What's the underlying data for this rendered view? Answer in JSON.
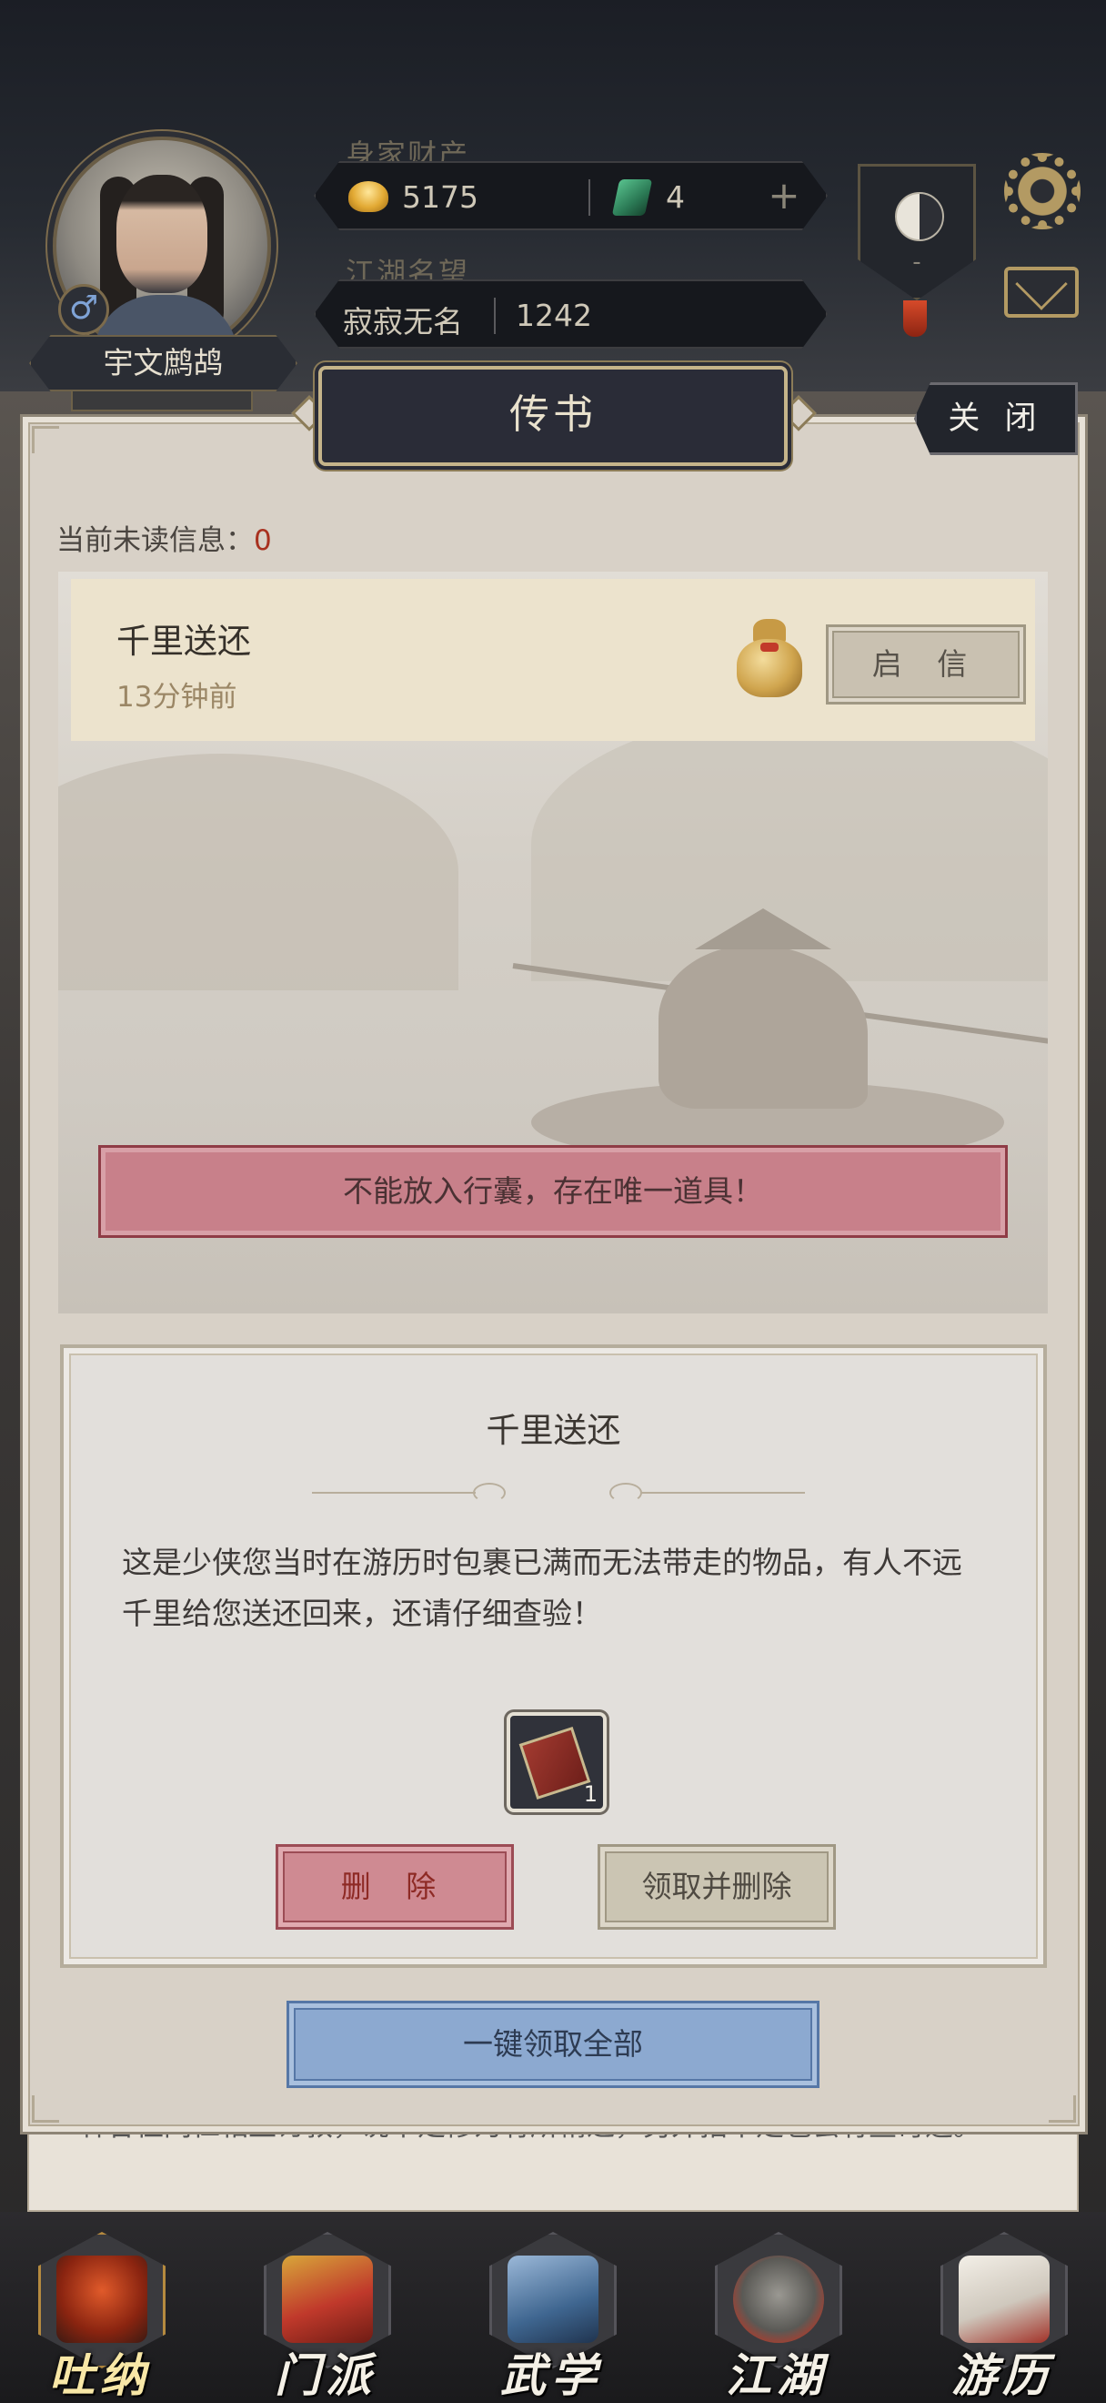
{
  "header": {
    "player_name": "宇文鹧鸪",
    "gender_symbol": "♂",
    "wealth_label": "身家财产",
    "gold": "5175",
    "jade": "4",
    "plus_symbol": "+",
    "fame_label": "江湖名望",
    "fame_title": "寂寂无名",
    "fame_value": "1242",
    "badge_dash": "-"
  },
  "dialog": {
    "title": "传书",
    "close_label": "关 闭",
    "unread_label": "当前未读信息：",
    "unread_count": "0",
    "letter": {
      "title": "千里送还",
      "time": "13分钟前",
      "open_label": "启 信"
    },
    "warning": "不能放入行囊，存在唯一道具！",
    "detail": {
      "title": "千里送还",
      "body": "这是少侠您当时在游历时包裹已满而无法带走的物品，有人不远千里给您送还回来，还请仔细查验！",
      "item_count": "1",
      "delete_label": "删 除",
      "claim_delete_label": "领取并删除"
    },
    "claim_all_label": "一键领取全部"
  },
  "background_text": "林各位同仁相互讨教，说不定修为有所精进，另外指不定也会有些奇遇。",
  "nav": [
    {
      "label": "吐纳",
      "icon": "meditation-icon"
    },
    {
      "label": "门派",
      "icon": "sect-banner-icon"
    },
    {
      "label": "武学",
      "icon": "martial-book-icon"
    },
    {
      "label": "江湖",
      "icon": "bamboo-hat-icon"
    },
    {
      "label": "游历",
      "icon": "horse-icon"
    }
  ],
  "colors": {
    "warning_bg": "#c8808a",
    "claim_all_bg": "#8ca9d0",
    "unread_count": "#a8311f"
  }
}
